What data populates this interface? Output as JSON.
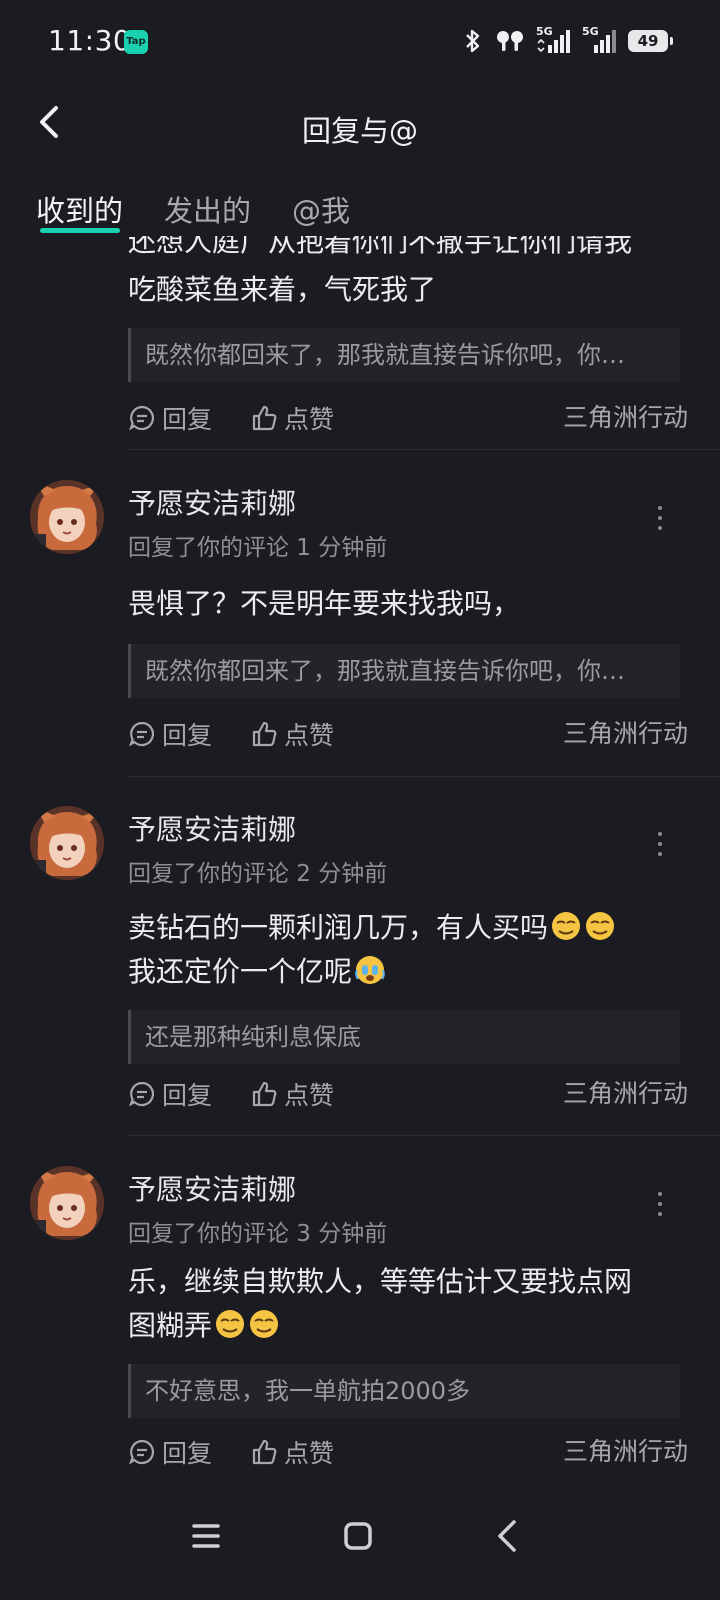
{
  "status_bar": {
    "time": "11:30",
    "app_badge": "Tap",
    "battery": "49",
    "network_1": "5G",
    "network_2": "5G"
  },
  "header": {
    "title": "回复与@"
  },
  "tabs": [
    {
      "label": "收到的"
    },
    {
      "label": "发出的"
    },
    {
      "label": "@我"
    }
  ],
  "partial_item": {
    "lines": [
      "还想人庭广从抱着你们不撒手让你们请我",
      "吃酸菜鱼来着，气死我了"
    ],
    "quote": "既然你都回来了，那我就直接告诉你吧，你…",
    "reply": "回复",
    "like": "点赞",
    "game": "三角洲行动"
  },
  "items": [
    {
      "username": "予愿安洁莉娜",
      "meta": "回复了你的评论 1 分钟前",
      "lines": [
        "畏惧了？不是明年要来找我吗，"
      ],
      "quote": "既然你都回来了，那我就直接告诉你吧，你…",
      "reply": "回复",
      "like": "点赞",
      "game": "三角洲行动"
    },
    {
      "username": "予愿安洁莉娜",
      "meta": "回复了你的评论 2 分钟前",
      "lines": [
        "卖钻石的一颗利润几万，有人买吗",
        "我还定价一个亿呢"
      ],
      "quote": "还是那种纯利息保底",
      "reply": "回复",
      "like": "点赞",
      "game": "三角洲行动"
    },
    {
      "username": "予愿安洁莉娜",
      "meta": "回复了你的评论 3 分钟前",
      "lines": [
        "乐，继续自欺欺人，等等估计又要找点网",
        "图糊弄"
      ],
      "quote": "不好意思，我一单航拍2000多",
      "reply": "回复",
      "like": "点赞",
      "game": "三角洲行动"
    }
  ],
  "icons": {
    "back": "chevron-left-icon",
    "more": "more-vertical-icon",
    "reply": "comment-icon",
    "like": "thumbs-up-icon",
    "emoji_smile": "smirk-emoji-icon",
    "emoji_cry": "crying-emoji-icon",
    "nav": [
      "menu-icon",
      "home-square-icon",
      "back-triangle-icon"
    ]
  },
  "colors": {
    "background": "#1b1c21",
    "accent": "#19d1b0",
    "text": "#ececef",
    "muted": "#a6a7ad"
  }
}
